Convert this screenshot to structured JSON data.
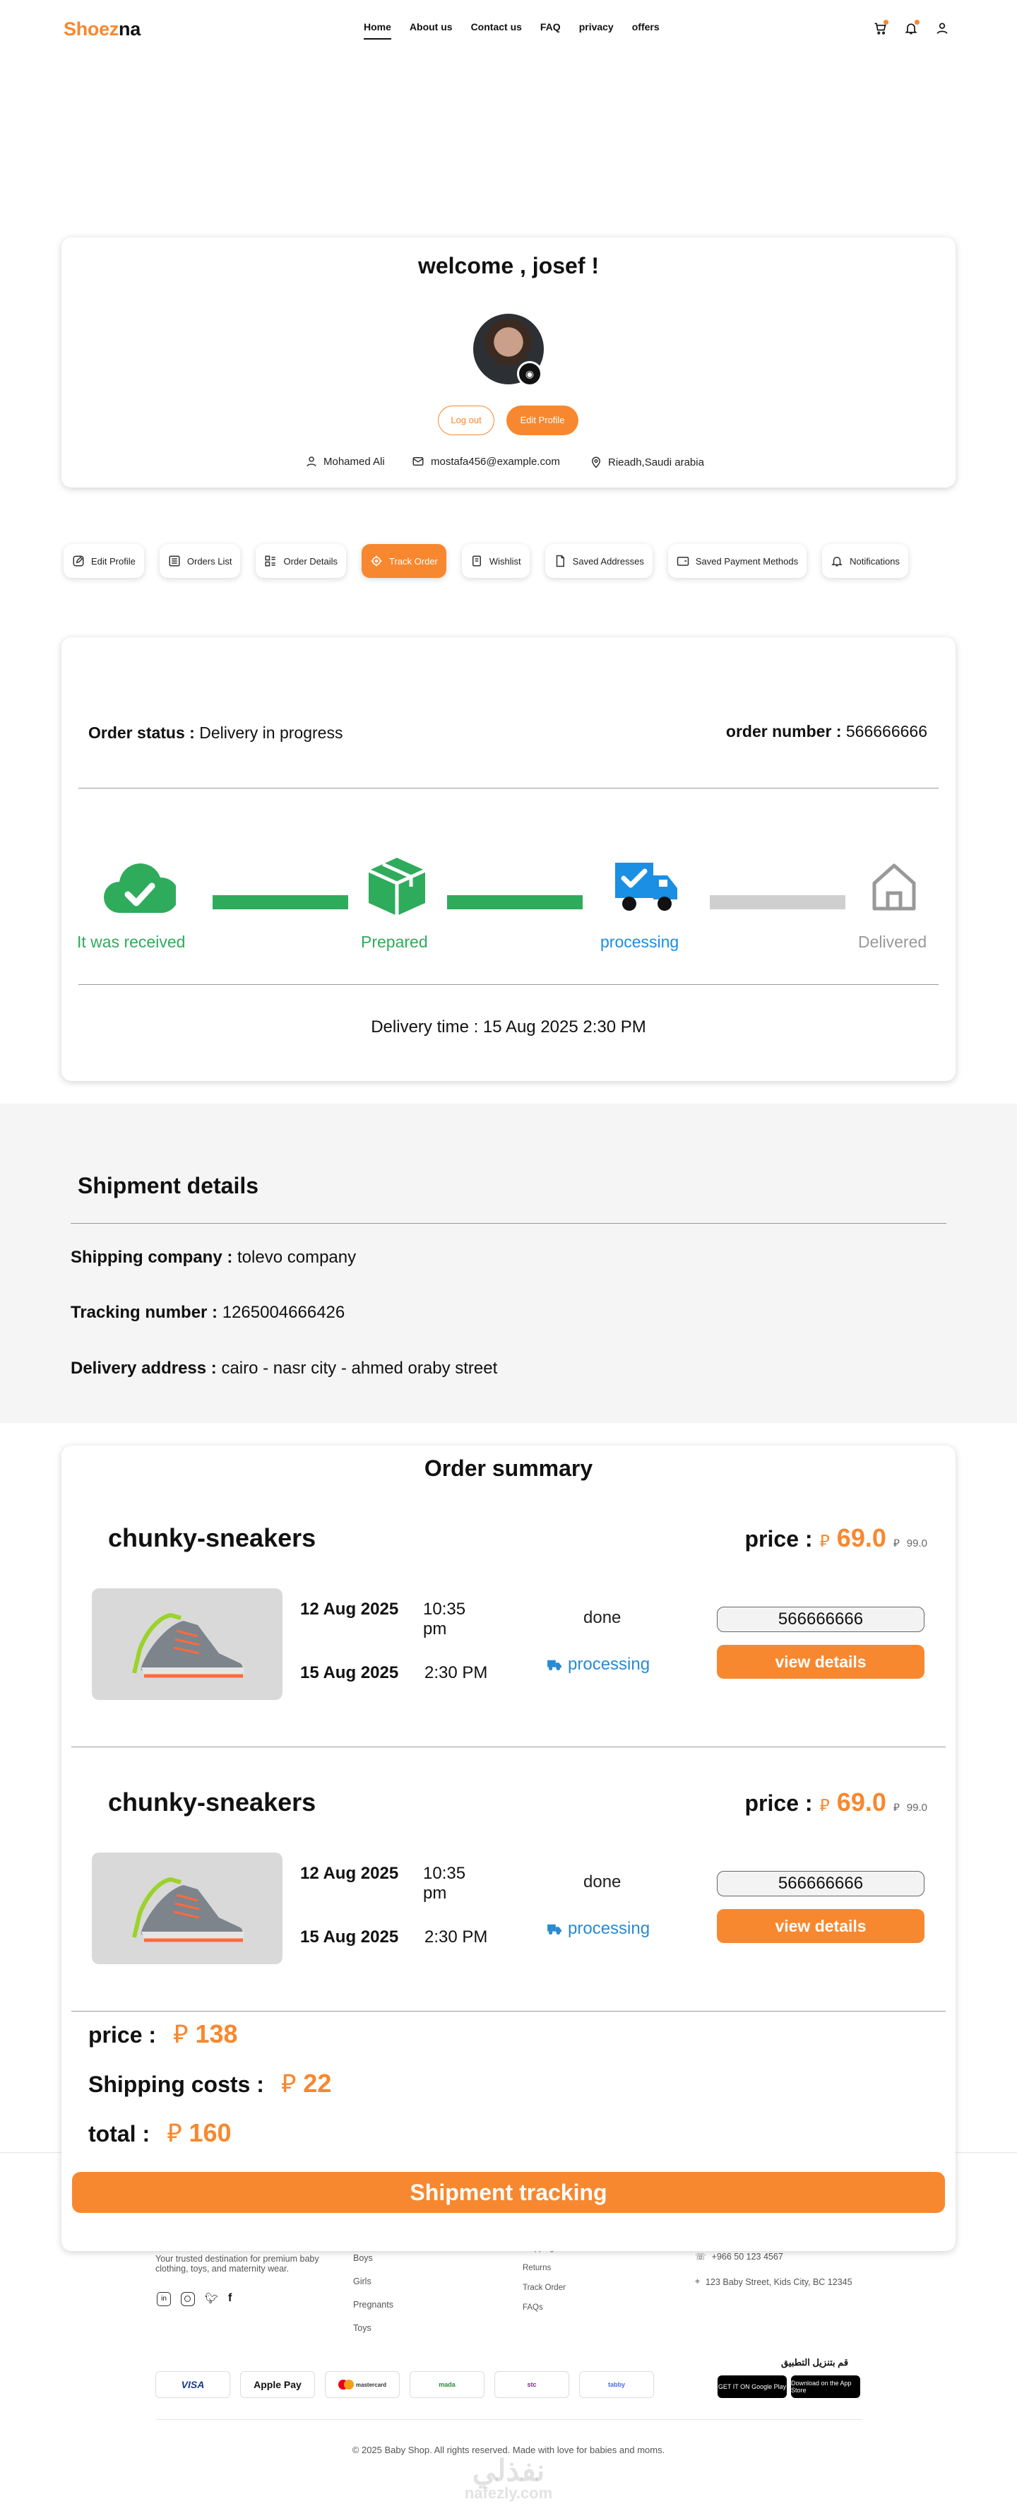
{
  "header": {
    "logo_part1": "Shoez",
    "logo_part2": "na",
    "nav": [
      "Home",
      "About us",
      "Contact us",
      "FAQ",
      "privacy",
      "offers"
    ]
  },
  "profile": {
    "welcome": "welcome , josef !",
    "logout": "Log out",
    "edit": "Edit Profile",
    "name": "Mohamed Ali",
    "email": "mostafa456@example.com",
    "location": "Rieadh,Saudi arabia"
  },
  "tabs": [
    "Edit Profile",
    "Orders List",
    "Order Details",
    "Track Order",
    "Wishlist",
    "Saved Addresses",
    "Saved Payment Methods",
    "Notifications"
  ],
  "tracking": {
    "status_label": "Order status",
    "status_sep": ":",
    "status_value": "Delivery in progress",
    "number_label": "order number :",
    "number_value": "566666666",
    "steps": [
      "It was received",
      "Prepared",
      "processing",
      "Delivered"
    ],
    "delivery_time": "Delivery time : 15 Aug 2025  2:30 PM"
  },
  "shipment": {
    "title": "Shipment details",
    "company_label": "Shipping company :",
    "company": "tolevo company",
    "tracking_label": "Tracking number :",
    "tracking": "1265004666426",
    "address_label": "Delivery address :",
    "address": "cairo - nasr city - ahmed oraby street"
  },
  "summary": {
    "title": "Order summary",
    "items": [
      {
        "name": "chunky-sneakers",
        "price_label": "price :",
        "currency": "⃁",
        "price": "69.0",
        "old_price": "99.0",
        "date1": "12 Aug 2025",
        "time1": "10:35",
        "time1b": "pm",
        "date2": "15 Aug 2025",
        "time2": "2:30 PM",
        "done": "done",
        "processing": "processing",
        "order_no": "566666666",
        "view": "view details"
      },
      {
        "name": "chunky-sneakers",
        "price_label": "price :",
        "currency": "⃁",
        "price": "69.0",
        "old_price": "99.0",
        "date1": "12 Aug 2025",
        "time1": "10:35",
        "time1b": "pm",
        "date2": "15 Aug 2025",
        "time2": "2:30 PM",
        "done": "done",
        "processing": "processing",
        "order_no": "566666666",
        "view": "view details"
      }
    ],
    "price_label": "price :",
    "price": "138",
    "shipping_label": "Shipping costs :",
    "shipping": "22",
    "total_label": "total :",
    "total": "160",
    "track_btn": "Shipment tracking"
  },
  "footer": {
    "tagline1": "Your trusted destination for premium baby",
    "tagline2": "clothing, toys, and maternity wear.",
    "cats": [
      "Boys",
      "Girls",
      "Pregnants",
      "Toys"
    ],
    "links": [
      "Shipping Info",
      "Returns",
      "Track Order",
      "FAQs"
    ],
    "phone": "+966 50 123 4567",
    "address": "123 Baby Street, Kids City, BC 12345",
    "payments": [
      "VISA",
      "Apple Pay",
      "mastercard",
      "mada",
      "stc",
      "tabby"
    ],
    "app_label": "قم بتنزيل التطبيق",
    "google": "GET IT ON Google Play",
    "apple": "Download on the App Store",
    "copyright": "© 2025 Baby Shop. All rights reserved. Made with love for babies and moms.",
    "watermark_ar": "نفذلي",
    "watermark": "nafezly.com"
  },
  "colors": {
    "accent": "#f7882f",
    "green": "#2eac5b",
    "blue": "#1a8fe3",
    "gray": "#cfcfcf"
  }
}
